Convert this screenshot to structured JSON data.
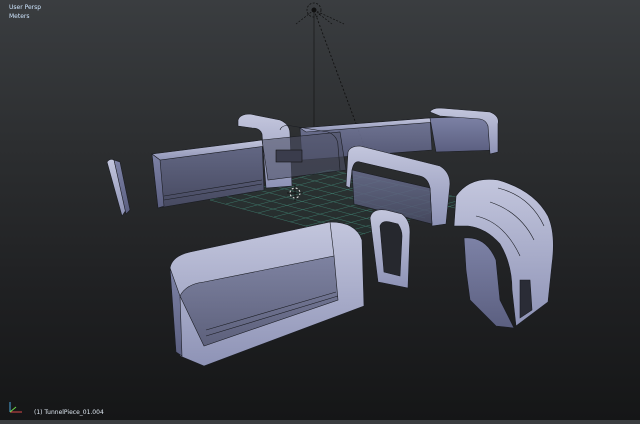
{
  "viewport": {
    "view_name": "User Persp",
    "units": "Meters",
    "active_object": "(1) TunnelPiece_01.004"
  },
  "colors": {
    "background_top": "#3a3d40",
    "background_bottom": "#151617",
    "mesh_face": "#9aa0c4",
    "mesh_edge": "#1a1c22",
    "grid": "#4fb39a",
    "hud_text": "#cfe6ff"
  },
  "icons": [
    "lamp-icon",
    "cursor-3d-icon",
    "axis-gizmo-icon"
  ]
}
